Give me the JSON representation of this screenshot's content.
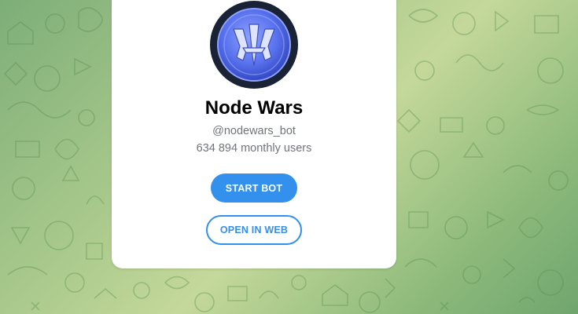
{
  "bot": {
    "name": "Node Wars",
    "username": "@nodewars_bot",
    "monthly_users": "634 894 monthly users",
    "avatar_icon": "node-wars-logo-icon"
  },
  "actions": {
    "start_label": "START BOT",
    "web_label": "OPEN IN WEB"
  },
  "colors": {
    "accent": "#3390ec",
    "background": "#9cc283",
    "card": "#ffffff",
    "secondary_text": "#707579"
  }
}
